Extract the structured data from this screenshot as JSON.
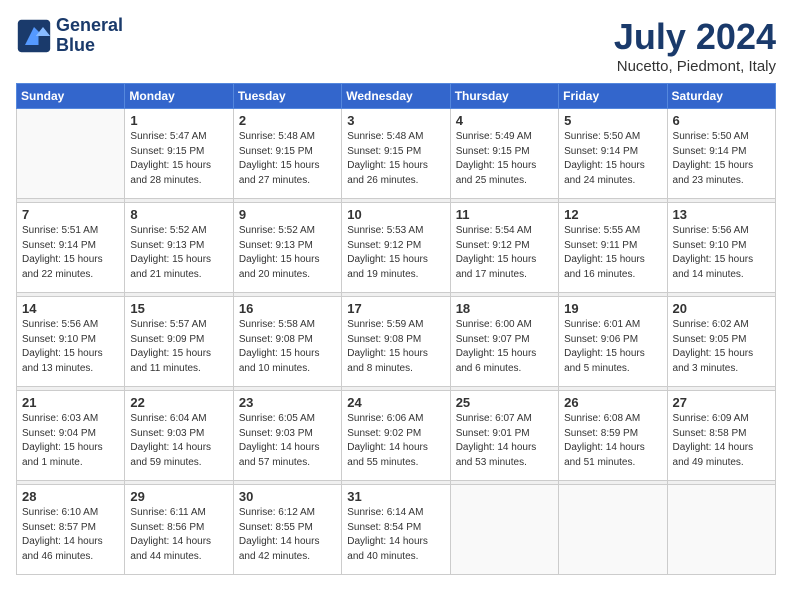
{
  "logo": {
    "line1": "General",
    "line2": "Blue"
  },
  "title": "July 2024",
  "location": "Nucetto, Piedmont, Italy",
  "days_of_week": [
    "Sunday",
    "Monday",
    "Tuesday",
    "Wednesday",
    "Thursday",
    "Friday",
    "Saturday"
  ],
  "weeks": [
    [
      {
        "day": "",
        "sunrise": "",
        "sunset": "",
        "daylight": ""
      },
      {
        "day": "1",
        "sunrise": "Sunrise: 5:47 AM",
        "sunset": "Sunset: 9:15 PM",
        "daylight": "Daylight: 15 hours and 28 minutes."
      },
      {
        "day": "2",
        "sunrise": "Sunrise: 5:48 AM",
        "sunset": "Sunset: 9:15 PM",
        "daylight": "Daylight: 15 hours and 27 minutes."
      },
      {
        "day": "3",
        "sunrise": "Sunrise: 5:48 AM",
        "sunset": "Sunset: 9:15 PM",
        "daylight": "Daylight: 15 hours and 26 minutes."
      },
      {
        "day": "4",
        "sunrise": "Sunrise: 5:49 AM",
        "sunset": "Sunset: 9:15 PM",
        "daylight": "Daylight: 15 hours and 25 minutes."
      },
      {
        "day": "5",
        "sunrise": "Sunrise: 5:50 AM",
        "sunset": "Sunset: 9:14 PM",
        "daylight": "Daylight: 15 hours and 24 minutes."
      },
      {
        "day": "6",
        "sunrise": "Sunrise: 5:50 AM",
        "sunset": "Sunset: 9:14 PM",
        "daylight": "Daylight: 15 hours and 23 minutes."
      }
    ],
    [
      {
        "day": "7",
        "sunrise": "Sunrise: 5:51 AM",
        "sunset": "Sunset: 9:14 PM",
        "daylight": "Daylight: 15 hours and 22 minutes."
      },
      {
        "day": "8",
        "sunrise": "Sunrise: 5:52 AM",
        "sunset": "Sunset: 9:13 PM",
        "daylight": "Daylight: 15 hours and 21 minutes."
      },
      {
        "day": "9",
        "sunrise": "Sunrise: 5:52 AM",
        "sunset": "Sunset: 9:13 PM",
        "daylight": "Daylight: 15 hours and 20 minutes."
      },
      {
        "day": "10",
        "sunrise": "Sunrise: 5:53 AM",
        "sunset": "Sunset: 9:12 PM",
        "daylight": "Daylight: 15 hours and 19 minutes."
      },
      {
        "day": "11",
        "sunrise": "Sunrise: 5:54 AM",
        "sunset": "Sunset: 9:12 PM",
        "daylight": "Daylight: 15 hours and 17 minutes."
      },
      {
        "day": "12",
        "sunrise": "Sunrise: 5:55 AM",
        "sunset": "Sunset: 9:11 PM",
        "daylight": "Daylight: 15 hours and 16 minutes."
      },
      {
        "day": "13",
        "sunrise": "Sunrise: 5:56 AM",
        "sunset": "Sunset: 9:10 PM",
        "daylight": "Daylight: 15 hours and 14 minutes."
      }
    ],
    [
      {
        "day": "14",
        "sunrise": "Sunrise: 5:56 AM",
        "sunset": "Sunset: 9:10 PM",
        "daylight": "Daylight: 15 hours and 13 minutes."
      },
      {
        "day": "15",
        "sunrise": "Sunrise: 5:57 AM",
        "sunset": "Sunset: 9:09 PM",
        "daylight": "Daylight: 15 hours and 11 minutes."
      },
      {
        "day": "16",
        "sunrise": "Sunrise: 5:58 AM",
        "sunset": "Sunset: 9:08 PM",
        "daylight": "Daylight: 15 hours and 10 minutes."
      },
      {
        "day": "17",
        "sunrise": "Sunrise: 5:59 AM",
        "sunset": "Sunset: 9:08 PM",
        "daylight": "Daylight: 15 hours and 8 minutes."
      },
      {
        "day": "18",
        "sunrise": "Sunrise: 6:00 AM",
        "sunset": "Sunset: 9:07 PM",
        "daylight": "Daylight: 15 hours and 6 minutes."
      },
      {
        "day": "19",
        "sunrise": "Sunrise: 6:01 AM",
        "sunset": "Sunset: 9:06 PM",
        "daylight": "Daylight: 15 hours and 5 minutes."
      },
      {
        "day": "20",
        "sunrise": "Sunrise: 6:02 AM",
        "sunset": "Sunset: 9:05 PM",
        "daylight": "Daylight: 15 hours and 3 minutes."
      }
    ],
    [
      {
        "day": "21",
        "sunrise": "Sunrise: 6:03 AM",
        "sunset": "Sunset: 9:04 PM",
        "daylight": "Daylight: 15 hours and 1 minute."
      },
      {
        "day": "22",
        "sunrise": "Sunrise: 6:04 AM",
        "sunset": "Sunset: 9:03 PM",
        "daylight": "Daylight: 14 hours and 59 minutes."
      },
      {
        "day": "23",
        "sunrise": "Sunrise: 6:05 AM",
        "sunset": "Sunset: 9:03 PM",
        "daylight": "Daylight: 14 hours and 57 minutes."
      },
      {
        "day": "24",
        "sunrise": "Sunrise: 6:06 AM",
        "sunset": "Sunset: 9:02 PM",
        "daylight": "Daylight: 14 hours and 55 minutes."
      },
      {
        "day": "25",
        "sunrise": "Sunrise: 6:07 AM",
        "sunset": "Sunset: 9:01 PM",
        "daylight": "Daylight: 14 hours and 53 minutes."
      },
      {
        "day": "26",
        "sunrise": "Sunrise: 6:08 AM",
        "sunset": "Sunset: 8:59 PM",
        "daylight": "Daylight: 14 hours and 51 minutes."
      },
      {
        "day": "27",
        "sunrise": "Sunrise: 6:09 AM",
        "sunset": "Sunset: 8:58 PM",
        "daylight": "Daylight: 14 hours and 49 minutes."
      }
    ],
    [
      {
        "day": "28",
        "sunrise": "Sunrise: 6:10 AM",
        "sunset": "Sunset: 8:57 PM",
        "daylight": "Daylight: 14 hours and 46 minutes."
      },
      {
        "day": "29",
        "sunrise": "Sunrise: 6:11 AM",
        "sunset": "Sunset: 8:56 PM",
        "daylight": "Daylight: 14 hours and 44 minutes."
      },
      {
        "day": "30",
        "sunrise": "Sunrise: 6:12 AM",
        "sunset": "Sunset: 8:55 PM",
        "daylight": "Daylight: 14 hours and 42 minutes."
      },
      {
        "day": "31",
        "sunrise": "Sunrise: 6:14 AM",
        "sunset": "Sunset: 8:54 PM",
        "daylight": "Daylight: 14 hours and 40 minutes."
      },
      {
        "day": "",
        "sunrise": "",
        "sunset": "",
        "daylight": ""
      },
      {
        "day": "",
        "sunrise": "",
        "sunset": "",
        "daylight": ""
      },
      {
        "day": "",
        "sunrise": "",
        "sunset": "",
        "daylight": ""
      }
    ]
  ]
}
